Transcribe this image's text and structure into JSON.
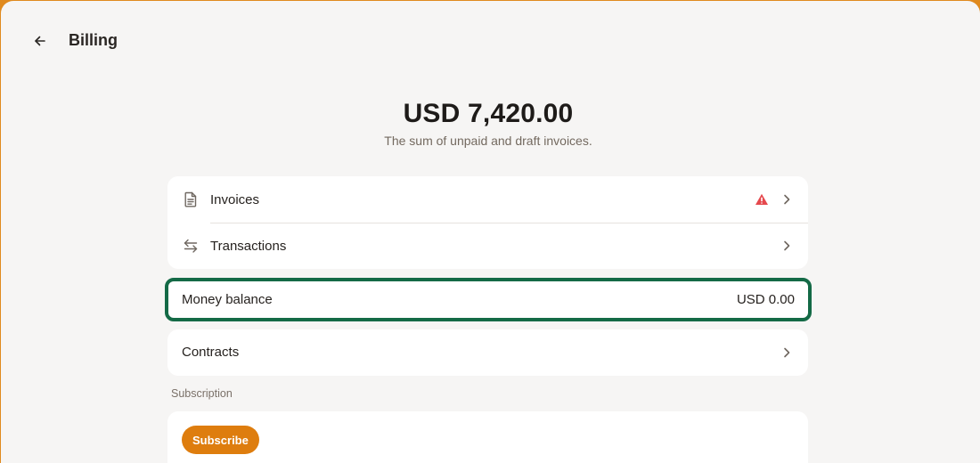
{
  "header": {
    "back_icon": "arrow-left-icon",
    "title": "Billing"
  },
  "summary": {
    "total": "USD 7,420.00",
    "caption": "The sum of unpaid and draft invoices."
  },
  "nav": {
    "items": [
      {
        "label": "Invoices",
        "icon": "document-icon",
        "alert_icon": "warning-triangle-icon",
        "alert_color": "#e5484d"
      },
      {
        "label": "Transactions",
        "icon": "arrows-left-right-icon"
      }
    ]
  },
  "balance": {
    "label": "Money balance",
    "value": "USD 0.00",
    "highlight_color": "#146a46"
  },
  "contracts": {
    "label": "Contracts"
  },
  "subscription": {
    "section_label": "Subscription",
    "button_label": "Subscribe",
    "button_color": "#de7d0e"
  },
  "colors": {
    "frame": "#e08a1e",
    "background": "#f6f5f4",
    "card": "#ffffff"
  }
}
